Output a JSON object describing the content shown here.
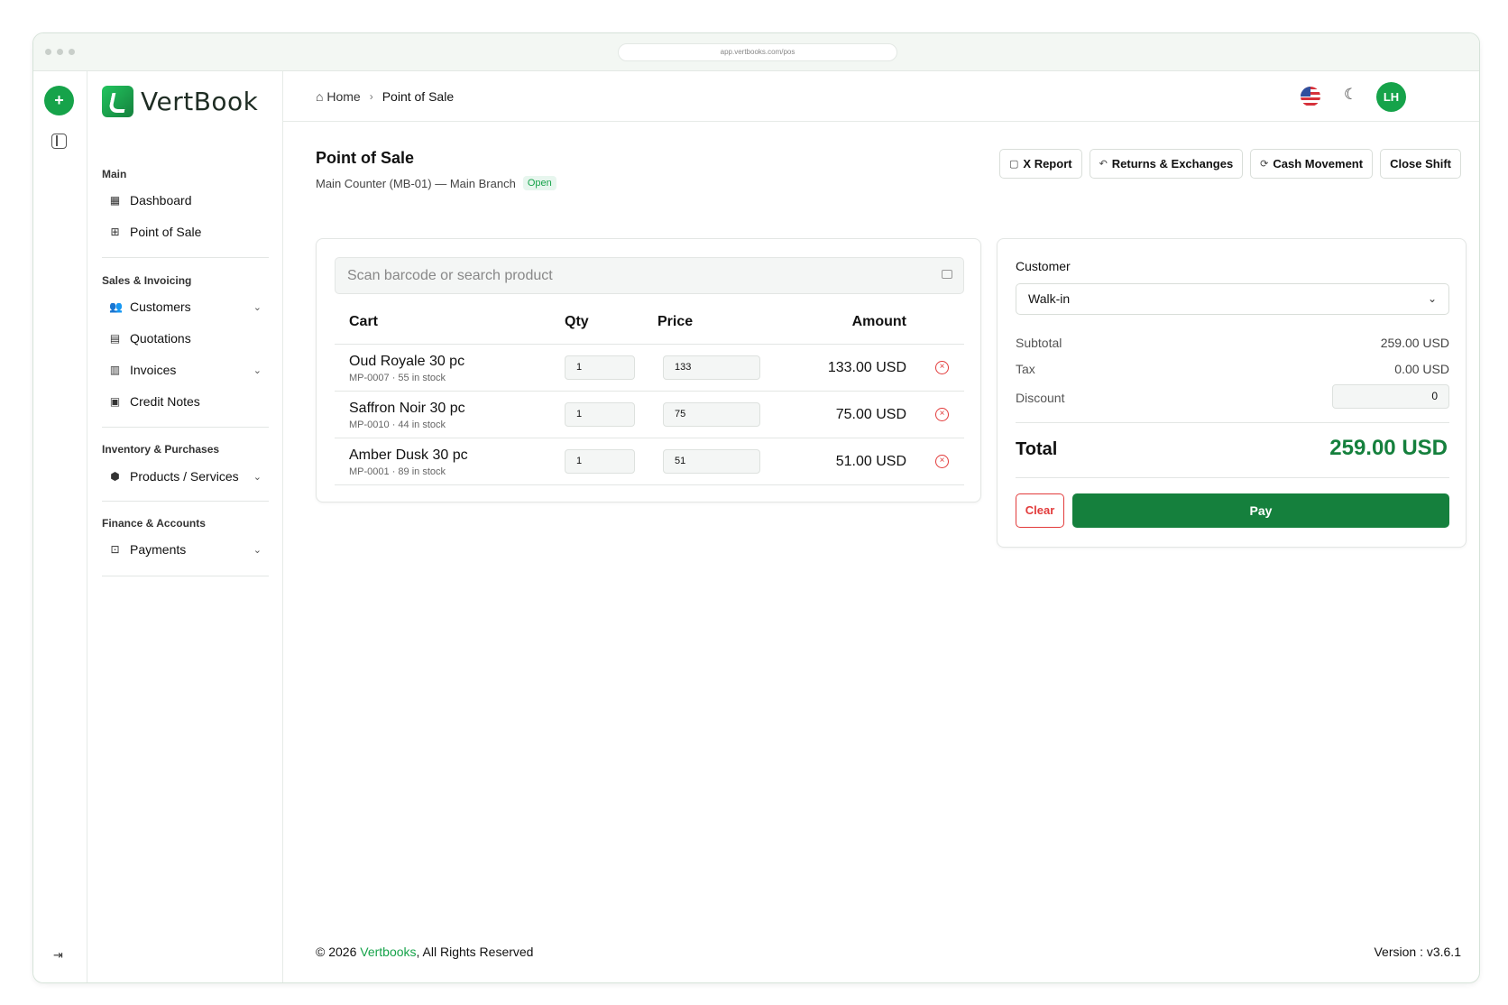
{
  "browser": {
    "url": "app.vertbooks.com/pos"
  },
  "brand": {
    "name": "VertBook"
  },
  "sidebar": {
    "sections": [
      {
        "title": "Main",
        "items": [
          {
            "label": "Dashboard"
          },
          {
            "label": "Point of Sale"
          }
        ]
      },
      {
        "title": "Sales & Invoicing",
        "items": [
          {
            "label": "Customers"
          },
          {
            "label": "Quotations"
          },
          {
            "label": "Invoices"
          },
          {
            "label": "Credit Notes"
          }
        ]
      },
      {
        "title": "Inventory & Purchases",
        "items": [
          {
            "label": "Products / Services"
          }
        ]
      },
      {
        "title": "Finance & Accounts",
        "items": [
          {
            "label": "Payments"
          }
        ]
      }
    ]
  },
  "breadcrumb": {
    "home": "Home",
    "current": "Point of Sale"
  },
  "user": {
    "initials": "LH"
  },
  "page": {
    "title": "Point of Sale",
    "subtitle": "Main Counter (MB-01) — Main Branch",
    "status": "Open"
  },
  "actions": {
    "x_report": "X Report",
    "returns": "Returns & Exchanges",
    "cash_movement": "Cash Movement",
    "close_shift": "Close Shift"
  },
  "search": {
    "placeholder": "Scan barcode or search product"
  },
  "cart": {
    "headers": {
      "cart": "Cart",
      "qty": "Qty",
      "price": "Price",
      "amount": "Amount"
    },
    "rows": [
      {
        "name": "Oud Royale 30 pc",
        "meta": "MP-0007 · 55 in stock",
        "qty": "1",
        "price": "133",
        "amount": "133.00 USD"
      },
      {
        "name": "Saffron Noir 30 pc",
        "meta": "MP-0010 · 44 in stock",
        "qty": "1",
        "price": "75",
        "amount": "75.00 USD"
      },
      {
        "name": "Amber Dusk 30 pc",
        "meta": "MP-0001 · 89 in stock",
        "qty": "1",
        "price": "51",
        "amount": "51.00 USD"
      }
    ]
  },
  "summary": {
    "customer_label": "Customer",
    "customer_value": "Walk-in",
    "subtotal_label": "Subtotal",
    "subtotal": "259.00 USD",
    "tax_label": "Tax",
    "tax": "0.00 USD",
    "discount_label": "Discount",
    "discount": "0",
    "total_label": "Total",
    "total": "259.00 USD",
    "clear": "Clear",
    "pay": "Pay"
  },
  "footer": {
    "copy_pre": "© 2026 ",
    "copy_brand": "Vertbooks",
    "copy_post": ", All Rights Reserved",
    "version": "Version : v3.6.1"
  },
  "colors": {
    "accent": "#16a34a",
    "accent_dark": "#15803d",
    "danger": "#e23b3b"
  }
}
